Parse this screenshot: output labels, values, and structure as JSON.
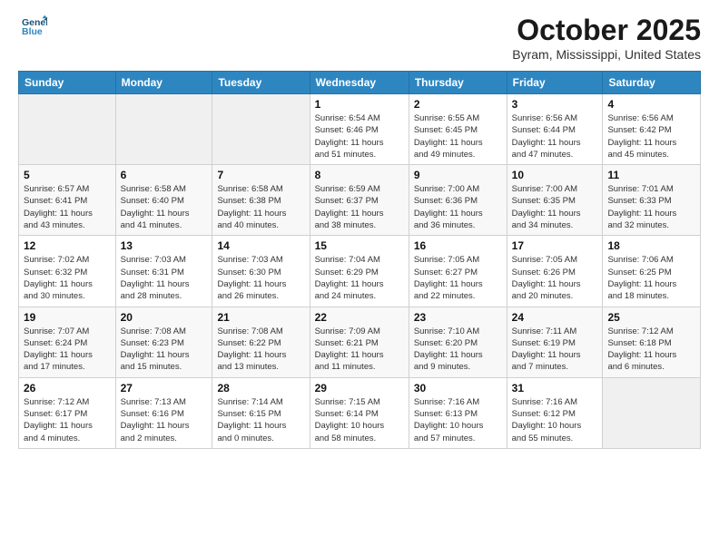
{
  "logo": {
    "line1": "General",
    "line2": "Blue"
  },
  "title": "October 2025",
  "location": "Byram, Mississippi, United States",
  "days_header": [
    "Sunday",
    "Monday",
    "Tuesday",
    "Wednesday",
    "Thursday",
    "Friday",
    "Saturday"
  ],
  "weeks": [
    [
      {
        "day": "",
        "info": ""
      },
      {
        "day": "",
        "info": ""
      },
      {
        "day": "",
        "info": ""
      },
      {
        "day": "1",
        "info": "Sunrise: 6:54 AM\nSunset: 6:46 PM\nDaylight: 11 hours\nand 51 minutes."
      },
      {
        "day": "2",
        "info": "Sunrise: 6:55 AM\nSunset: 6:45 PM\nDaylight: 11 hours\nand 49 minutes."
      },
      {
        "day": "3",
        "info": "Sunrise: 6:56 AM\nSunset: 6:44 PM\nDaylight: 11 hours\nand 47 minutes."
      },
      {
        "day": "4",
        "info": "Sunrise: 6:56 AM\nSunset: 6:42 PM\nDaylight: 11 hours\nand 45 minutes."
      }
    ],
    [
      {
        "day": "5",
        "info": "Sunrise: 6:57 AM\nSunset: 6:41 PM\nDaylight: 11 hours\nand 43 minutes."
      },
      {
        "day": "6",
        "info": "Sunrise: 6:58 AM\nSunset: 6:40 PM\nDaylight: 11 hours\nand 41 minutes."
      },
      {
        "day": "7",
        "info": "Sunrise: 6:58 AM\nSunset: 6:38 PM\nDaylight: 11 hours\nand 40 minutes."
      },
      {
        "day": "8",
        "info": "Sunrise: 6:59 AM\nSunset: 6:37 PM\nDaylight: 11 hours\nand 38 minutes."
      },
      {
        "day": "9",
        "info": "Sunrise: 7:00 AM\nSunset: 6:36 PM\nDaylight: 11 hours\nand 36 minutes."
      },
      {
        "day": "10",
        "info": "Sunrise: 7:00 AM\nSunset: 6:35 PM\nDaylight: 11 hours\nand 34 minutes."
      },
      {
        "day": "11",
        "info": "Sunrise: 7:01 AM\nSunset: 6:33 PM\nDaylight: 11 hours\nand 32 minutes."
      }
    ],
    [
      {
        "day": "12",
        "info": "Sunrise: 7:02 AM\nSunset: 6:32 PM\nDaylight: 11 hours\nand 30 minutes."
      },
      {
        "day": "13",
        "info": "Sunrise: 7:03 AM\nSunset: 6:31 PM\nDaylight: 11 hours\nand 28 minutes."
      },
      {
        "day": "14",
        "info": "Sunrise: 7:03 AM\nSunset: 6:30 PM\nDaylight: 11 hours\nand 26 minutes."
      },
      {
        "day": "15",
        "info": "Sunrise: 7:04 AM\nSunset: 6:29 PM\nDaylight: 11 hours\nand 24 minutes."
      },
      {
        "day": "16",
        "info": "Sunrise: 7:05 AM\nSunset: 6:27 PM\nDaylight: 11 hours\nand 22 minutes."
      },
      {
        "day": "17",
        "info": "Sunrise: 7:05 AM\nSunset: 6:26 PM\nDaylight: 11 hours\nand 20 minutes."
      },
      {
        "day": "18",
        "info": "Sunrise: 7:06 AM\nSunset: 6:25 PM\nDaylight: 11 hours\nand 18 minutes."
      }
    ],
    [
      {
        "day": "19",
        "info": "Sunrise: 7:07 AM\nSunset: 6:24 PM\nDaylight: 11 hours\nand 17 minutes."
      },
      {
        "day": "20",
        "info": "Sunrise: 7:08 AM\nSunset: 6:23 PM\nDaylight: 11 hours\nand 15 minutes."
      },
      {
        "day": "21",
        "info": "Sunrise: 7:08 AM\nSunset: 6:22 PM\nDaylight: 11 hours\nand 13 minutes."
      },
      {
        "day": "22",
        "info": "Sunrise: 7:09 AM\nSunset: 6:21 PM\nDaylight: 11 hours\nand 11 minutes."
      },
      {
        "day": "23",
        "info": "Sunrise: 7:10 AM\nSunset: 6:20 PM\nDaylight: 11 hours\nand 9 minutes."
      },
      {
        "day": "24",
        "info": "Sunrise: 7:11 AM\nSunset: 6:19 PM\nDaylight: 11 hours\nand 7 minutes."
      },
      {
        "day": "25",
        "info": "Sunrise: 7:12 AM\nSunset: 6:18 PM\nDaylight: 11 hours\nand 6 minutes."
      }
    ],
    [
      {
        "day": "26",
        "info": "Sunrise: 7:12 AM\nSunset: 6:17 PM\nDaylight: 11 hours\nand 4 minutes."
      },
      {
        "day": "27",
        "info": "Sunrise: 7:13 AM\nSunset: 6:16 PM\nDaylight: 11 hours\nand 2 minutes."
      },
      {
        "day": "28",
        "info": "Sunrise: 7:14 AM\nSunset: 6:15 PM\nDaylight: 11 hours\nand 0 minutes."
      },
      {
        "day": "29",
        "info": "Sunrise: 7:15 AM\nSunset: 6:14 PM\nDaylight: 10 hours\nand 58 minutes."
      },
      {
        "day": "30",
        "info": "Sunrise: 7:16 AM\nSunset: 6:13 PM\nDaylight: 10 hours\nand 57 minutes."
      },
      {
        "day": "31",
        "info": "Sunrise: 7:16 AM\nSunset: 6:12 PM\nDaylight: 10 hours\nand 55 minutes."
      },
      {
        "day": "",
        "info": ""
      }
    ]
  ]
}
